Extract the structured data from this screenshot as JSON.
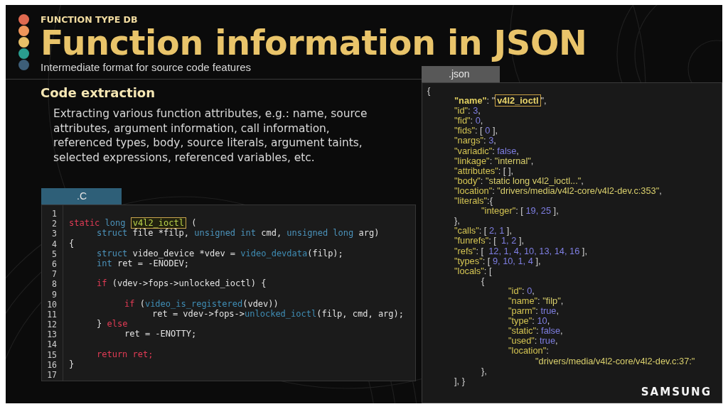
{
  "header": {
    "dots": [
      {
        "color": "#e06a50"
      },
      {
        "color": "#f0965a"
      },
      {
        "color": "#e8c068"
      },
      {
        "color": "#2a9d8f"
      },
      {
        "color": "#3d5e78"
      }
    ],
    "kicker": "FUNCTION TYPE DB",
    "title": "Function information in JSON",
    "subtitle": "Intermediate format for source code features"
  },
  "section": {
    "heading": "Code extraction",
    "text": "Extracting various function attributes, e.g.: name, source attributes, argument information, call information, referenced types, body, source literals, argument taints, selected expressions, referenced variables, etc."
  },
  "code_panel": {
    "tab": ".C",
    "lines": [
      {
        "number": "1"
      },
      {
        "number": "2",
        "tokens": [
          {
            "kind": "keyword",
            "text": "static"
          },
          {
            "kind": "type",
            "text": " long "
          },
          {
            "kind": "highlight",
            "text": "v4l2_ioctl"
          },
          {
            "kind": "plain",
            "text": " ("
          }
        ]
      },
      {
        "number": "3",
        "tokens": [
          {
            "kind": "type",
            "text": "\tstruct"
          },
          {
            "kind": "plain",
            "text": " file *filp, "
          },
          {
            "kind": "type",
            "text": "unsigned int"
          },
          {
            "kind": "plain",
            "text": " cmd, "
          },
          {
            "kind": "type",
            "text": "unsigned long"
          },
          {
            "kind": "plain",
            "text": " arg)"
          }
        ]
      },
      {
        "number": "4",
        "tokens": [
          {
            "kind": "plain",
            "text": "{"
          }
        ]
      },
      {
        "number": "5",
        "tokens": [
          {
            "kind": "type",
            "text": "\tstruct"
          },
          {
            "kind": "plain",
            "text": " video_device *vdev = "
          },
          {
            "kind": "func",
            "text": "video_devdata"
          },
          {
            "kind": "plain",
            "text": "(filp);"
          }
        ]
      },
      {
        "number": "6",
        "tokens": [
          {
            "kind": "type",
            "text": "\tint"
          },
          {
            "kind": "plain",
            "text": " ret = -ENODEV;"
          }
        ]
      },
      {
        "number": "7"
      },
      {
        "number": "8",
        "tokens": [
          {
            "kind": "keyword",
            "text": "\tif"
          },
          {
            "kind": "plain",
            "text": " (vdev->fops->unlocked_ioctl) {"
          }
        ]
      },
      {
        "number": "9"
      },
      {
        "number": "10",
        "tokens": [
          {
            "kind": "keyword",
            "text": "\t\tif"
          },
          {
            "kind": "plain",
            "text": " ("
          },
          {
            "kind": "func",
            "text": "video_is_registered"
          },
          {
            "kind": "plain",
            "text": "(vdev))"
          }
        ]
      },
      {
        "number": "11",
        "tokens": [
          {
            "kind": "plain",
            "text": "\t\t\tret = vdev->fops->"
          },
          {
            "kind": "func",
            "text": "unlocked_ioctl"
          },
          {
            "kind": "plain",
            "text": "(filp, cmd, arg);"
          }
        ]
      },
      {
        "number": "12",
        "tokens": [
          {
            "kind": "plain",
            "text": "\t} "
          },
          {
            "kind": "keyword",
            "text": "else"
          }
        ]
      },
      {
        "number": "13",
        "tokens": [
          {
            "kind": "plain",
            "text": "\t\tret = -ENOTTY;"
          }
        ]
      },
      {
        "number": "14"
      },
      {
        "number": "15",
        "tokens": [
          {
            "kind": "keyword",
            "text": "\treturn ret;"
          }
        ]
      },
      {
        "number": "16",
        "tokens": [
          {
            "kind": "plain",
            "text": "}"
          }
        ]
      },
      {
        "number": "17"
      }
    ]
  },
  "json_panel": {
    "tab": ".json",
    "lines": [
      {
        "tokens": [
          {
            "kind": "punct",
            "text": "{"
          }
        ]
      },
      {
        "tokens": [
          {
            "kind": "bold_key",
            "text": "\t\"name\""
          },
          {
            "kind": "punct",
            "text": ": \""
          },
          {
            "kind": "highlight",
            "text": "v4l2_ioctl"
          },
          {
            "kind": "punct",
            "text": "\","
          }
        ]
      },
      {
        "tokens": [
          {
            "kind": "key",
            "text": "\t\"id\""
          },
          {
            "kind": "punct",
            "text": ": "
          },
          {
            "kind": "literal",
            "text": "3"
          },
          {
            "kind": "punct",
            "text": ","
          }
        ]
      },
      {
        "tokens": [
          {
            "kind": "key",
            "text": "\t\"fid\""
          },
          {
            "kind": "punct",
            "text": ": "
          },
          {
            "kind": "literal",
            "text": "0"
          },
          {
            "kind": "punct",
            "text": ","
          }
        ]
      },
      {
        "tokens": [
          {
            "kind": "key",
            "text": "\t\"fids\""
          },
          {
            "kind": "punct",
            "text": ": [ "
          },
          {
            "kind": "literal",
            "text": "0"
          },
          {
            "kind": "punct",
            "text": " ],"
          }
        ]
      },
      {
        "tokens": [
          {
            "kind": "key",
            "text": "\t\"nargs\""
          },
          {
            "kind": "punct",
            "text": ": "
          },
          {
            "kind": "literal",
            "text": "3"
          },
          {
            "kind": "punct",
            "text": ","
          }
        ]
      },
      {
        "tokens": [
          {
            "kind": "key",
            "text": "\t\"variadic\""
          },
          {
            "kind": "punct",
            "text": ": "
          },
          {
            "kind": "literal",
            "text": "false"
          },
          {
            "kind": "punct",
            "text": ","
          }
        ]
      },
      {
        "tokens": [
          {
            "kind": "key",
            "text": "\t\"linkage\""
          },
          {
            "kind": "punct",
            "text": ": "
          },
          {
            "kind": "string",
            "text": "\"internal\""
          },
          {
            "kind": "punct",
            "text": ","
          }
        ]
      },
      {
        "tokens": [
          {
            "kind": "key",
            "text": "\t\"attributes\""
          },
          {
            "kind": "punct",
            "text": ": [ ],"
          }
        ]
      },
      {
        "tokens": [
          {
            "kind": "key",
            "text": "\t\"body\""
          },
          {
            "kind": "punct",
            "text": ": "
          },
          {
            "kind": "string",
            "text": "\"static long v4l2_ioctl...\""
          },
          {
            "kind": "punct",
            "text": ","
          }
        ]
      },
      {
        "tokens": [
          {
            "kind": "key",
            "text": "\t\"location\""
          },
          {
            "kind": "punct",
            "text": ": "
          },
          {
            "kind": "string",
            "text": "\"drivers/media/v4l2-core/v4l2-dev.c:353\""
          },
          {
            "kind": "punct",
            "text": ","
          }
        ]
      },
      {
        "tokens": [
          {
            "kind": "key",
            "text": "\t\"literals\""
          },
          {
            "kind": "punct",
            "text": ":{"
          }
        ]
      },
      {
        "tokens": [
          {
            "kind": "key",
            "text": "\t\t\"integer\""
          },
          {
            "kind": "punct",
            "text": ": [ "
          },
          {
            "kind": "literal",
            "text": "19, 25"
          },
          {
            "kind": "punct",
            "text": " ],"
          }
        ]
      },
      {
        "tokens": [
          {
            "kind": "punct",
            "text": "\t},"
          }
        ]
      },
      {
        "tokens": [
          {
            "kind": "key",
            "text": "\t\"calls\""
          },
          {
            "kind": "punct",
            "text": ": [ "
          },
          {
            "kind": "literal",
            "text": "2, 1"
          },
          {
            "kind": "punct",
            "text": " ],"
          }
        ]
      },
      {
        "tokens": [
          {
            "kind": "key",
            "text": "\t\"funrefs\""
          },
          {
            "kind": "punct",
            "text": ": [  "
          },
          {
            "kind": "literal",
            "text": "1, 2"
          },
          {
            "kind": "punct",
            "text": " ],"
          }
        ]
      },
      {
        "tokens": [
          {
            "kind": "key",
            "text": "\t\"refs\""
          },
          {
            "kind": "punct",
            "text": ": [  "
          },
          {
            "kind": "literal",
            "text": "12, 1, 4, 10, 13, 14, 16"
          },
          {
            "kind": "punct",
            "text": " ],"
          }
        ]
      },
      {
        "tokens": [
          {
            "kind": "key",
            "text": "\t\"types\""
          },
          {
            "kind": "punct",
            "text": ": [ "
          },
          {
            "kind": "literal",
            "text": "9, 10, 1, 4"
          },
          {
            "kind": "punct",
            "text": " ],"
          }
        ]
      },
      {
        "tokens": [
          {
            "kind": "key",
            "text": "\t\"locals\""
          },
          {
            "kind": "punct",
            "text": ": ["
          }
        ]
      },
      {
        "tokens": [
          {
            "kind": "punct",
            "text": "\t\t{"
          }
        ]
      },
      {
        "tokens": [
          {
            "kind": "key",
            "text": "\t\t\t\"id\""
          },
          {
            "kind": "punct",
            "text": ": "
          },
          {
            "kind": "literal",
            "text": "0"
          },
          {
            "kind": "punct",
            "text": ","
          }
        ]
      },
      {
        "tokens": [
          {
            "kind": "key",
            "text": "\t\t\t\"name\""
          },
          {
            "kind": "punct",
            "text": ": "
          },
          {
            "kind": "string",
            "text": "\"filp\""
          },
          {
            "kind": "punct",
            "text": ","
          }
        ]
      },
      {
        "tokens": [
          {
            "kind": "key",
            "text": "\t\t\t\"parm\""
          },
          {
            "kind": "punct",
            "text": ": "
          },
          {
            "kind": "literal",
            "text": "true"
          },
          {
            "kind": "punct",
            "text": ","
          }
        ]
      },
      {
        "tokens": [
          {
            "kind": "key",
            "text": "\t\t\t\"type\""
          },
          {
            "kind": "punct",
            "text": ": "
          },
          {
            "kind": "literal",
            "text": "10"
          },
          {
            "kind": "punct",
            "text": ","
          }
        ]
      },
      {
        "tokens": [
          {
            "kind": "key",
            "text": "\t\t\t\"static\""
          },
          {
            "kind": "punct",
            "text": ": "
          },
          {
            "kind": "literal",
            "text": "false"
          },
          {
            "kind": "punct",
            "text": ","
          }
        ]
      },
      {
        "tokens": [
          {
            "kind": "key",
            "text": "\t\t\t\"used\""
          },
          {
            "kind": "punct",
            "text": ": "
          },
          {
            "kind": "literal",
            "text": "true"
          },
          {
            "kind": "punct",
            "text": ","
          }
        ]
      },
      {
        "tokens": [
          {
            "kind": "key",
            "text": "\t\t\t\"location\""
          },
          {
            "kind": "punct",
            "text": ":"
          }
        ]
      },
      {
        "tokens": [
          {
            "kind": "string",
            "text": "\t\t\t\t\"drivers/media/v4l2-core/v4l2-dev.c:37:\""
          }
        ]
      },
      {
        "tokens": [
          {
            "kind": "punct",
            "text": "\t\t},"
          }
        ]
      },
      {
        "tokens": [
          {
            "kind": "punct",
            "text": "\t], }"
          }
        ]
      }
    ]
  },
  "logo": "SAMSUNG"
}
